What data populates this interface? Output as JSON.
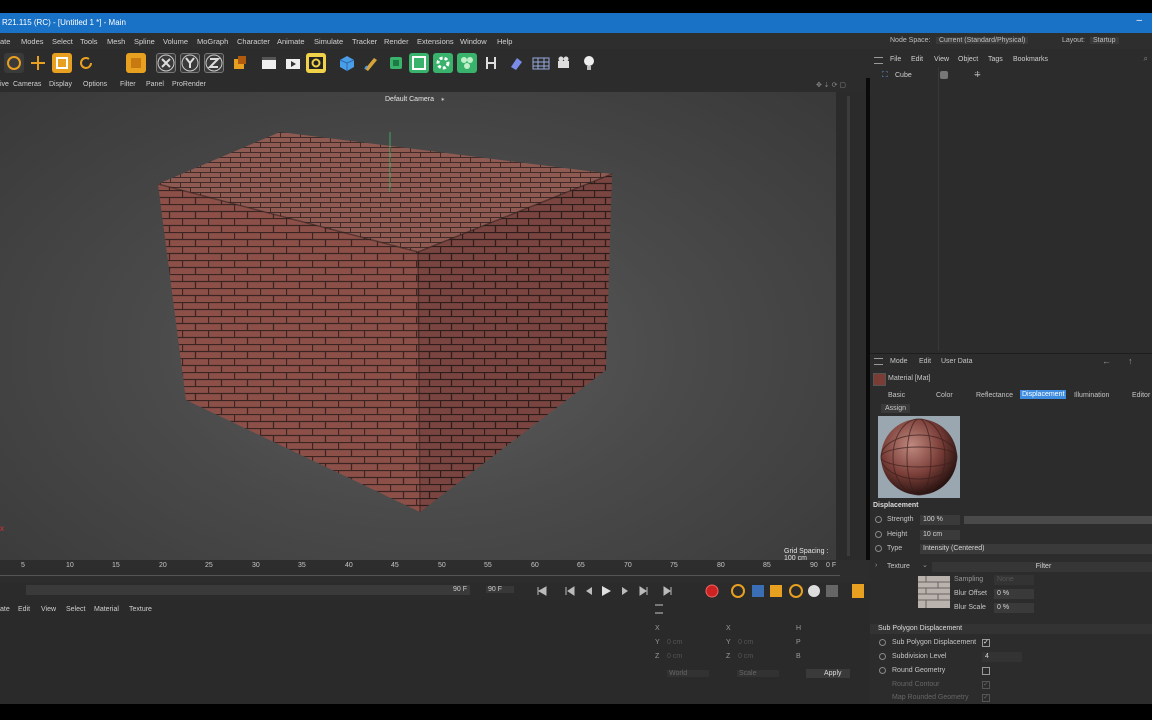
{
  "window": {
    "title": "R21.115 (RC) - [Untitled 1 *] - Main",
    "minimize": "–"
  },
  "menu": [
    "ate",
    "Modes",
    "Select",
    "Tools",
    "Mesh",
    "Spline",
    "Volume",
    "MoGraph",
    "Character",
    "Animate",
    "Simulate",
    "Tracker",
    "Render",
    "Extensions",
    "Window",
    "Help"
  ],
  "node_space": {
    "label": "Node Space:",
    "value": "Current (Standard/Physical)"
  },
  "layout": {
    "label": "Layout:",
    "value": "Startup"
  },
  "viewport_menu": [
    "ive",
    "Cameras",
    "Display",
    "Options",
    "Filter",
    "Panel",
    "ProRender"
  ],
  "viewport": {
    "camera_label": "Default Camera",
    "grid_spacing": "Grid Spacing : 100 cm",
    "x_marker": "x"
  },
  "timeline": {
    "ticks": [
      "5",
      "10",
      "15",
      "20",
      "25",
      "30",
      "35",
      "40",
      "45",
      "50",
      "55",
      "60",
      "65",
      "70",
      "75",
      "80",
      "85",
      "90"
    ],
    "end_frame": "0 F"
  },
  "transport": {
    "current": "0 F",
    "max_a": "90 F",
    "max_b": "90 F"
  },
  "material_menu": [
    "ate",
    "Edit",
    "View",
    "Select",
    "Material",
    "Texture"
  ],
  "coordinates": {
    "labels": [
      "X",
      "Y",
      "Z",
      "X",
      "Y",
      "Z",
      "H",
      "P",
      "B"
    ],
    "values": [
      "0 cm",
      "0 cm",
      "0 cm",
      "0 cm",
      "0 cm",
      "0 cm"
    ],
    "world": "World",
    "scale": "Scale",
    "apply": "Apply"
  },
  "object_manager": {
    "menu": [
      "File",
      "Edit",
      "View",
      "Object",
      "Tags",
      "Bookmarks"
    ],
    "object_name": "Cube"
  },
  "attributes": {
    "menu": [
      "Mode",
      "Edit",
      "User Data"
    ],
    "material_name": "Material [Mat]",
    "tabs": [
      "Basic",
      "Color",
      "Reflectance",
      "Displacement",
      "Illumination",
      "Editor"
    ],
    "active_tab": "Displacement",
    "assign_tab": "Assign",
    "section": "Displacement",
    "strength": {
      "label": "Strength",
      "value": "100 %"
    },
    "height": {
      "label": "Height",
      "value": "10 cm"
    },
    "type": {
      "label": "Type",
      "value": "Intensity (Centered)"
    },
    "texture": {
      "label": "Texture",
      "filter": "Filter"
    },
    "sampling": {
      "label": "Sampling",
      "value": "None"
    },
    "blur_offset": {
      "label": "Blur Offset",
      "value": "0 %"
    },
    "blur_scale": {
      "label": "Blur Scale",
      "value": "0 %"
    },
    "sub_poly_section": "Sub Polygon Displacement",
    "sub_poly": {
      "label": "Sub Polygon Displacement",
      "checked": "✓"
    },
    "subdivision": {
      "label": "Subdivision Level",
      "value": "4"
    },
    "round_geometry": "Round Geometry",
    "round_contour": {
      "label": "Round Contour",
      "checked": "✓"
    },
    "map_rounded": {
      "label": "Map Rounded Geometry",
      "checked": "✓"
    }
  },
  "colors": {
    "title_bar": "#1a72c6",
    "active_tab": "#3d8ce0",
    "brick": "#8a4a44"
  }
}
